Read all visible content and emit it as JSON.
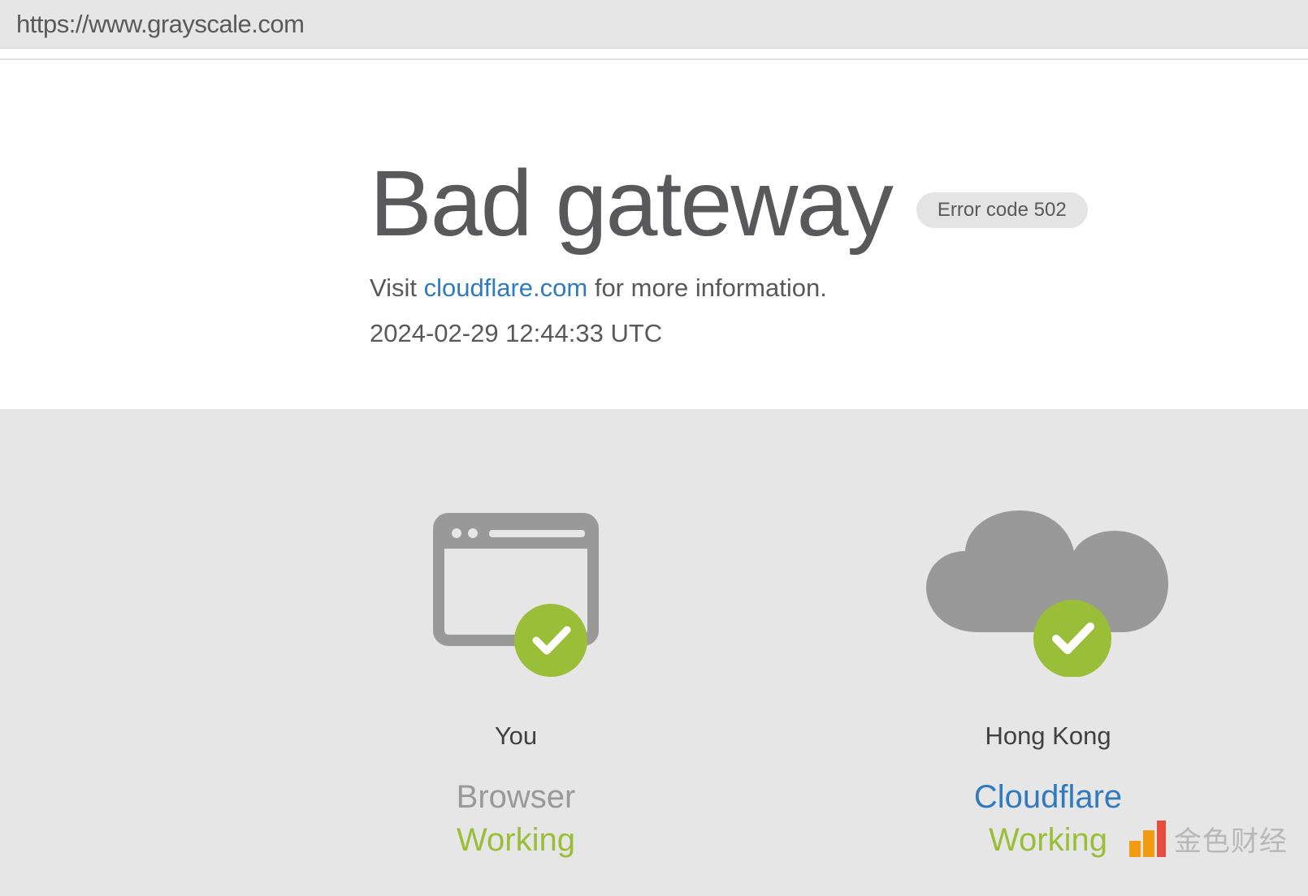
{
  "urlBar": {
    "url": "https://www.grayscale.com"
  },
  "error": {
    "title": "Bad gateway",
    "codeBadge": "Error code 502",
    "visitPrefix": "Visit ",
    "linkText": "cloudflare.com",
    "visitSuffix": " for more information.",
    "timestamp": "2024-02-29 12:44:33 UTC"
  },
  "status": {
    "browser": {
      "label": "You",
      "type": "Browser",
      "state": "Working"
    },
    "cloudflare": {
      "label": "Hong Kong",
      "type": "Cloudflare",
      "state": "Working"
    }
  },
  "watermark": {
    "text": "金色财经"
  }
}
